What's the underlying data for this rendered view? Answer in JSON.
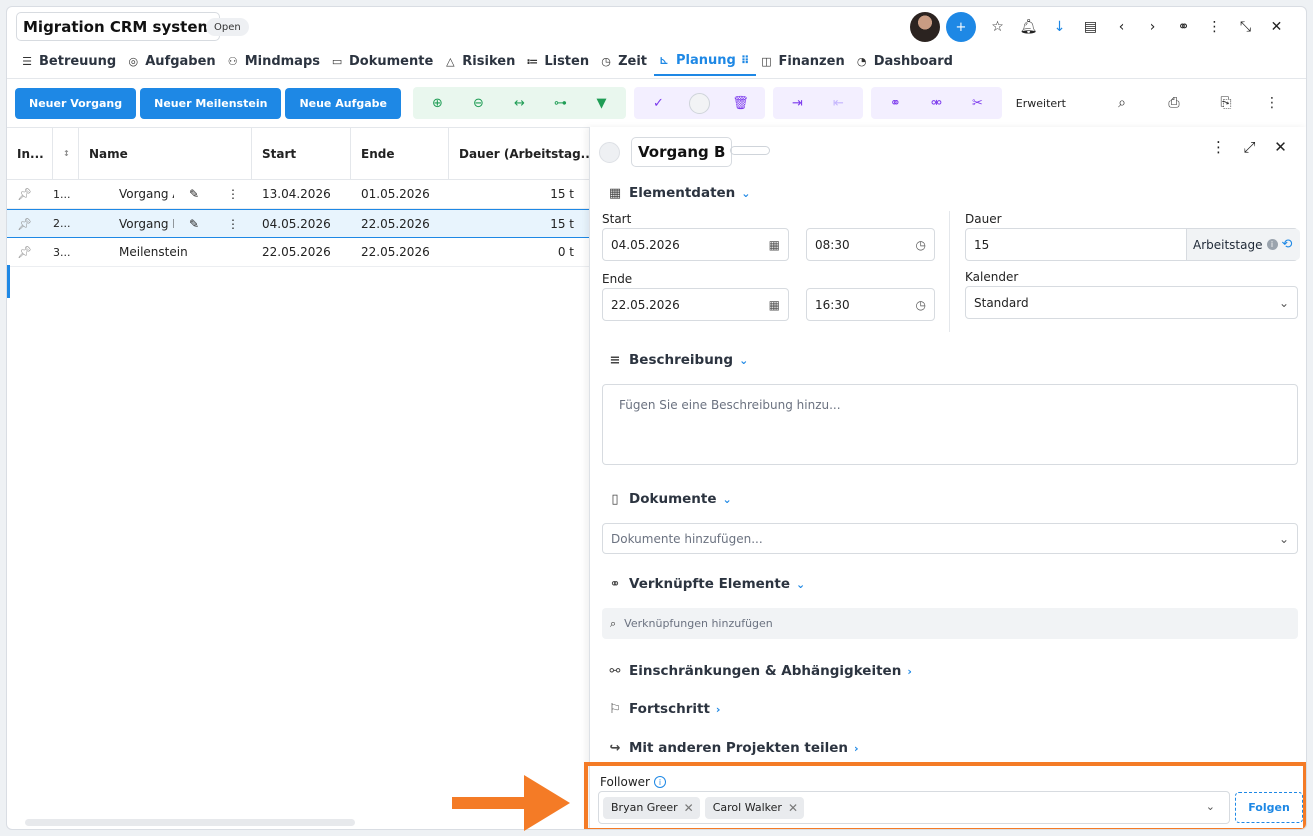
{
  "app": {
    "title": "Migration CRM system",
    "status": "Open"
  },
  "tabs": [
    {
      "label": "Betreuung",
      "icon": "sliders-icon"
    },
    {
      "label": "Aufgaben",
      "icon": "check-circle-icon"
    },
    {
      "label": "Mindmaps",
      "icon": "mindmap-icon"
    },
    {
      "label": "Dokumente",
      "icon": "folder-icon"
    },
    {
      "label": "Risiken",
      "icon": "warning-icon"
    },
    {
      "label": "Listen",
      "icon": "list-icon"
    },
    {
      "label": "Zeit",
      "icon": "clock-icon"
    },
    {
      "label": "Planung",
      "icon": "gantt-icon",
      "active": true
    },
    {
      "label": "Finanzen",
      "icon": "coins-icon"
    },
    {
      "label": "Dashboard",
      "icon": "dashboard-icon"
    }
  ],
  "toolbar": {
    "new_process": "Neuer Vorgang",
    "new_milestone": "Neuer Meilenstein",
    "new_task": "Neue Aufgabe",
    "advanced": "Erweitert"
  },
  "table": {
    "columns": [
      "In...",
      "↕",
      "Name",
      "Start",
      "Ende",
      "Dauer (Arbeitstag..."
    ],
    "rows": [
      {
        "index": "1...",
        "name": "Vorgang A",
        "start": "13.04.2026",
        "end": "01.05.2026",
        "duration": "15 t"
      },
      {
        "index": "2...",
        "name": "Vorgang B",
        "start": "04.05.2026",
        "end": "22.05.2026",
        "duration": "15 t",
        "selected": true
      },
      {
        "index": "3...",
        "name": "Meilenstein",
        "start": "22.05.2026",
        "end": "22.05.2026",
        "duration": "0 t"
      }
    ]
  },
  "panel": {
    "title": "Vorgang B",
    "sections": {
      "elementdata": "Elementdaten",
      "description": "Beschreibung",
      "documents": "Dokumente",
      "linked": "Verknüpfte Elemente",
      "constraints": "Einschränkungen & Abhängigkeiten",
      "progress": "Fortschritt",
      "share": "Mit anderen Projekten teilen"
    },
    "start_label": "Start",
    "start_date": "04.05.2026",
    "start_time": "08:30",
    "end_label": "Ende",
    "end_date": "22.05.2026",
    "end_time": "16:30",
    "duration_label": "Dauer",
    "duration_value": "15",
    "duration_unit": "Arbeitstage",
    "calendar_label": "Kalender",
    "calendar_value": "Standard",
    "description_placeholder": "Fügen Sie eine Beschreibung hinzu...",
    "documents_placeholder": "Dokumente hinzufügen...",
    "links_placeholder": "Verknüpfungen hinzufügen",
    "follower_label": "Follower",
    "followers": [
      "Bryan Greer",
      "Carol Walker"
    ],
    "follow_button": "Folgen"
  },
  "colors": {
    "accent": "#1e88e5",
    "highlight": "#f47b26",
    "green_group": "#e9f7ee",
    "purple_group": "#f3efff"
  }
}
